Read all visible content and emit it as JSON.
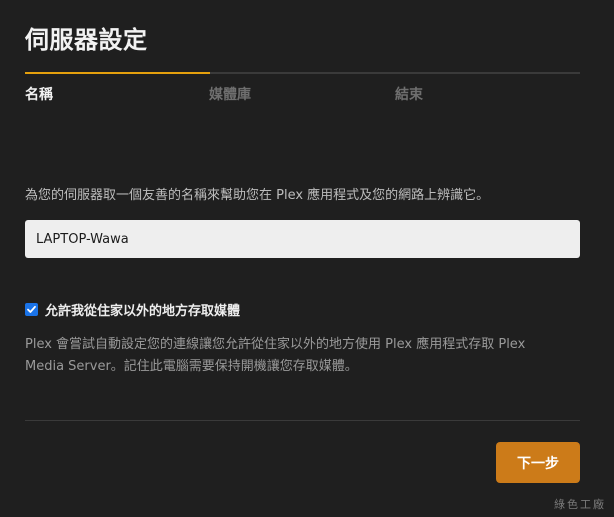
{
  "window": {
    "title": "伺服器設定"
  },
  "steps": {
    "items": [
      {
        "label": "名稱",
        "active": true
      },
      {
        "label": "媒體庫",
        "active": false
      },
      {
        "label": "結束",
        "active": false
      }
    ],
    "progress_fraction": 0.333,
    "accent_color": "#e5a00d"
  },
  "main": {
    "description": "為您的伺服器取一個友善的名稱來幫助您在 Plex 應用程式及您的網路上辨識它。",
    "server_name_input": {
      "value": "LAPTOP-Wawa",
      "placeholder": ""
    },
    "remote_access": {
      "checked": true,
      "label": "允許我從住家以外的地方存取媒體",
      "help": "Plex 會嘗試自動設定您的連線讓您允許從住家以外的地方使用 Plex 應用程式存取 Plex Media Server。記住此電腦需要保持開機讓您存取媒體。"
    }
  },
  "footer": {
    "next_label": "下一步",
    "button_color": "#cc7b19"
  },
  "watermark": "綠色工廠",
  "icons": {
    "checkbox": "check-icon"
  }
}
